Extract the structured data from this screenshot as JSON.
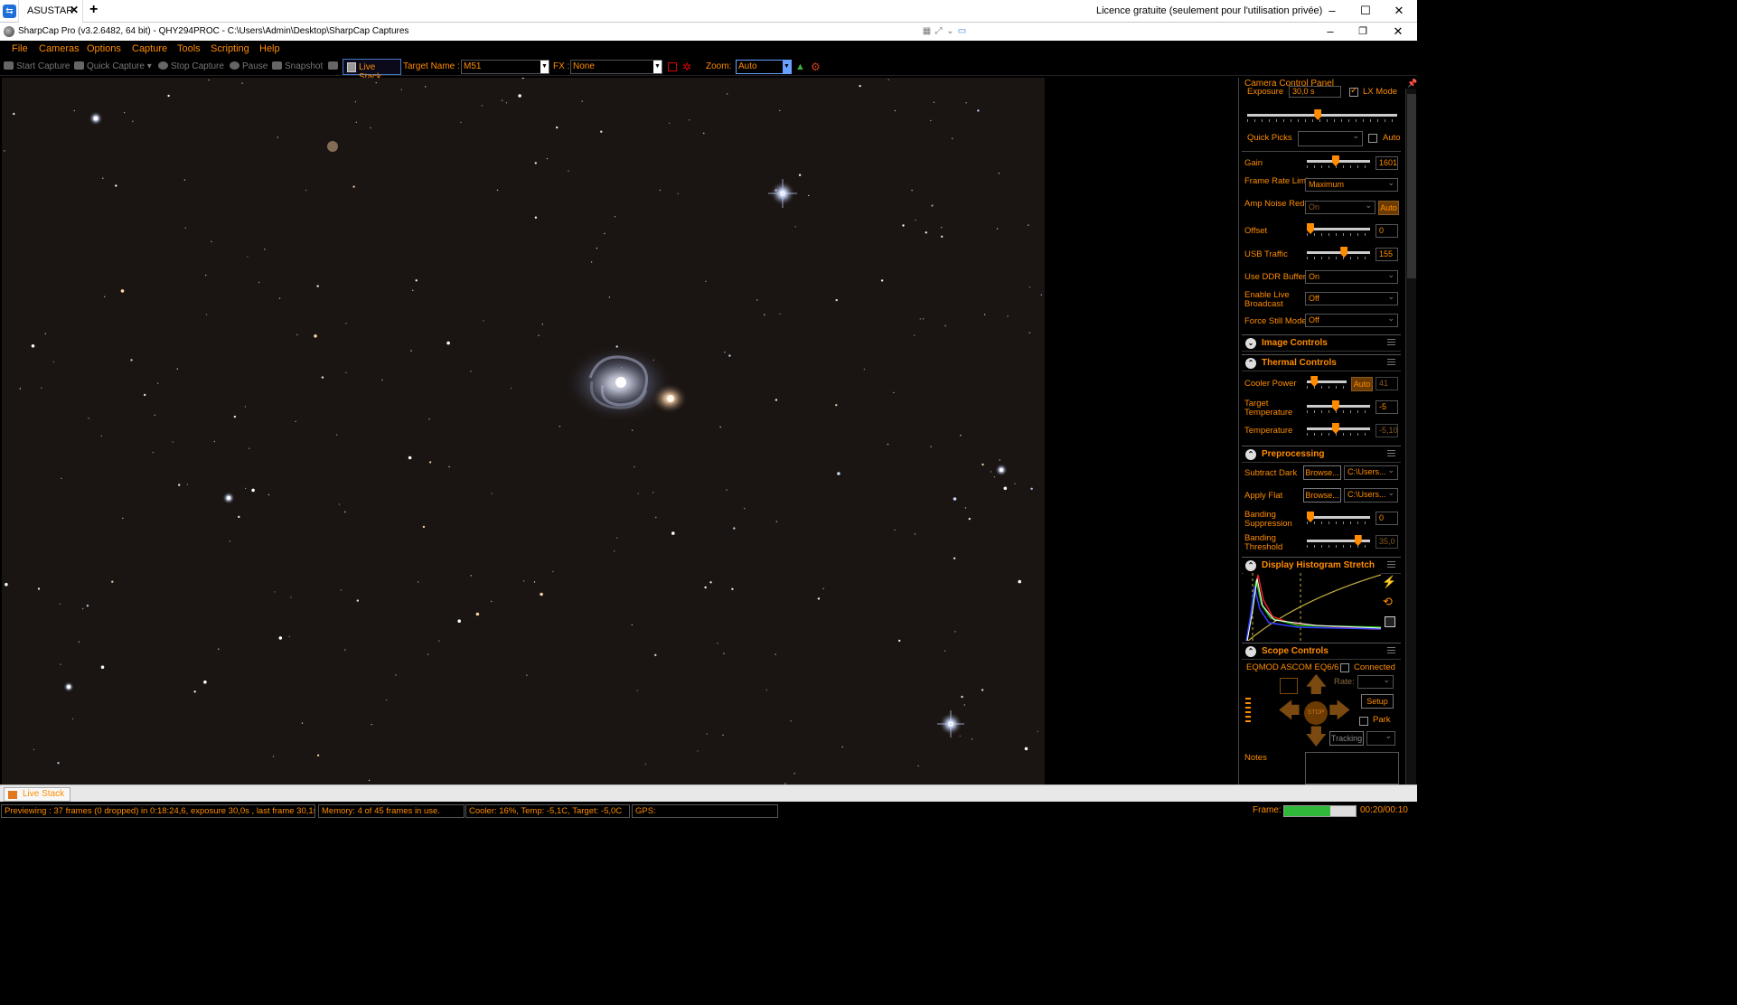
{
  "remote_desktop": {
    "tab_label": "ASUSTAR",
    "license_text": "Licence gratuite (seulement pour l'utilisation privée)"
  },
  "app": {
    "title": "SharpCap Pro (v3.2.6482, 64 bit) - QHY294PROC - C:\\Users\\Admin\\Desktop\\SharpCap Captures"
  },
  "menu": [
    "File",
    "Cameras",
    "Options",
    "Capture",
    "Tools",
    "Scripting",
    "Help"
  ],
  "toolbar": {
    "start_capture": "Start Capture",
    "quick_capture": "Quick Capture",
    "stop_capture": "Stop Capture",
    "pause": "Pause",
    "snapshot": "Snapshot",
    "live_stack": "Live Stack",
    "target_label": "Target Name :",
    "target_value": "M51",
    "fx_label": "FX :",
    "fx_value": "None",
    "zoom_label": "Zoom:",
    "zoom_value": "Auto"
  },
  "panel": {
    "title": "Camera Control Panel",
    "exposure_label": "Exposure",
    "exposure_value": "30,0 s",
    "lx_mode": "LX Mode",
    "exposure_level": 0.47,
    "quick_picks_label": "Quick Picks",
    "quick_picks_auto": "Auto",
    "gain_label": "Gain",
    "gain_value": "1601",
    "gain_level": 0.45,
    "frame_rate_label": "Frame Rate Limit",
    "frame_rate_value": "Maximum",
    "amp_noise_label": "Amp Noise Reduction",
    "amp_noise_value": "On",
    "amp_noise_auto": "Auto",
    "offset_label": "Offset",
    "offset_value": "0",
    "offset_level": 0.0,
    "usb_label": "USB Traffic",
    "usb_value": "155",
    "usb_level": 0.6,
    "ddr_label": "Use DDR Buffer",
    "ddr_value": "On",
    "broadcast_label": "Enable Live Broadcast",
    "broadcast_value": "Off",
    "force_still_label": "Force Still Mode",
    "force_still_value": "Off",
    "image_controls": "Image Controls",
    "thermal_controls": "Thermal Controls",
    "cooler_power_label": "Cooler Power",
    "cooler_power_auto": "Auto",
    "cooler_power_value": "41",
    "cooler_level": 0.12,
    "target_temp_label": "Target Temperature",
    "target_temp_value": "-5",
    "target_temp_level": 0.45,
    "temperature_label": "Temperature",
    "temperature_value": "-5,10",
    "temperature_level": 0.45,
    "preprocessing": "Preprocessing",
    "subtract_dark_label": "Subtract Dark",
    "apply_flat_label": "Apply Flat",
    "browse": "Browse...",
    "path_value": "C:\\Users...",
    "banding_supp_label": "Banding Suppression",
    "banding_supp_value": "0",
    "banding_supp_level": 0.0,
    "banding_thr_label": "Banding Threshold",
    "banding_thr_value": "35,0",
    "banding_thr_level": 0.85,
    "histogram": "Display Histogram Stretch",
    "scope_controls": "Scope Controls",
    "scope_name": "EQMOD ASCOM EQ6/6",
    "connected": "Connected",
    "rate_label": "Rate:",
    "setup": "Setup",
    "park": "Park",
    "tracking": "Tracking",
    "stop": "STOP",
    "notes_label": "Notes"
  },
  "bottom": {
    "tab_label": "Live Stack"
  },
  "status": {
    "preview": "Previewing : 37 frames (0 dropped) in 0:18:24,6, exposure 30,0s , last frame 30,1s",
    "memory": "Memory: 4 of 45 frames in use.",
    "cooler": "Cooler: 16%, Temp: -5,1C, Target: -5,0C",
    "gps": "GPS:",
    "frame_label": "Frame:",
    "frame_progress": 0.65,
    "frame_time": "00:20/00:10"
  },
  "colors": {
    "accent": "#ff8c00",
    "sky": "#1a1412",
    "progress": "#2fb83a"
  }
}
